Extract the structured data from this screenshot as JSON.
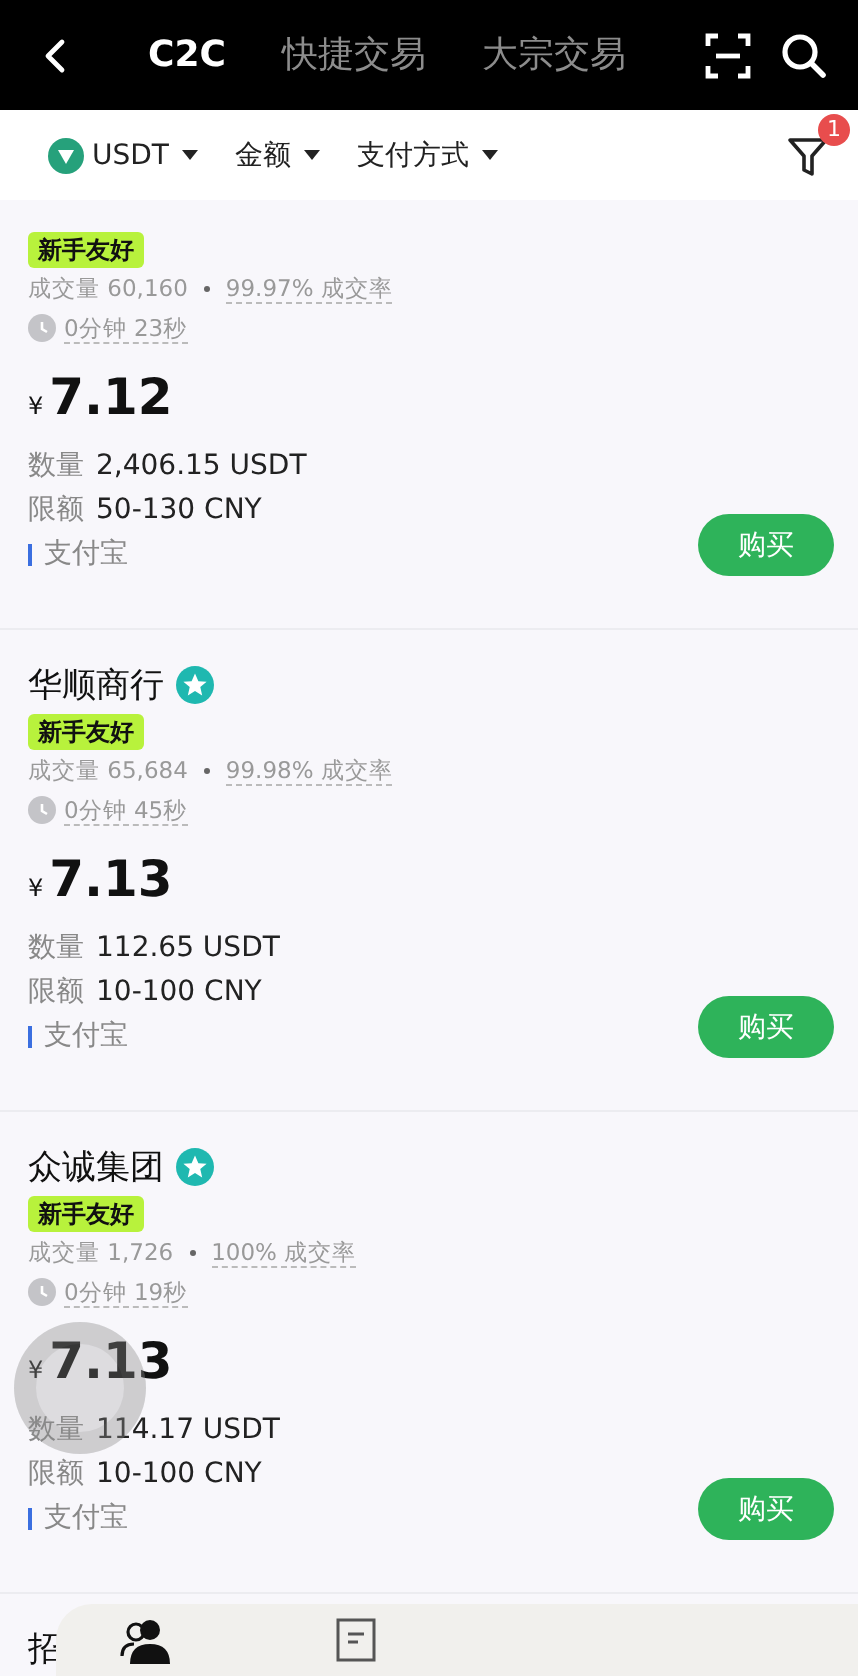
{
  "header": {
    "tabs": [
      {
        "label": "C2C",
        "selected": true
      },
      {
        "label": "快捷交易",
        "selected": false
      },
      {
        "label": "大宗交易",
        "selected": false
      }
    ]
  },
  "filters": {
    "items": [
      {
        "kind": "coin",
        "label": "USDT"
      },
      {
        "kind": "dropdown",
        "label": "金额"
      },
      {
        "kind": "dropdown",
        "label": "支付方式"
      }
    ],
    "badge": "1"
  },
  "ads": [
    {
      "tag": "新手友好",
      "volume": "成交量 60,160",
      "rate": "99.97% 成交率",
      "time": "0分钟 23秒",
      "currency": "¥",
      "price": "7.12",
      "quantity_label": "数量",
      "quantity": "2,406.15 USDT",
      "limit_label": "限额",
      "limit": "50-130 CNY",
      "payment": "支付宝",
      "button": "购买"
    },
    {
      "name": "华顺商行",
      "verified": true,
      "tag": "新手友好",
      "volume": "成交量 65,684",
      "rate": "99.98% 成交率",
      "time": "0分钟 45秒",
      "currency": "¥",
      "price": "7.13",
      "quantity_label": "数量",
      "quantity": "112.65 USDT",
      "limit_label": "限额",
      "limit": "10-100 CNY",
      "payment": "支付宝",
      "button": "购买"
    },
    {
      "name": "众诚集团",
      "verified": true,
      "tag": "新手友好",
      "volume": "成交量 1,726",
      "rate": "100% 成交率",
      "time": "0分钟 19秒",
      "currency": "¥",
      "price": "7.13",
      "quantity_label": "数量",
      "quantity": "114.17 USDT",
      "limit_label": "限额",
      "limit": "10-100 CNY",
      "payment": "支付宝",
      "button": "购买"
    },
    {
      "name": "招"
    }
  ]
}
